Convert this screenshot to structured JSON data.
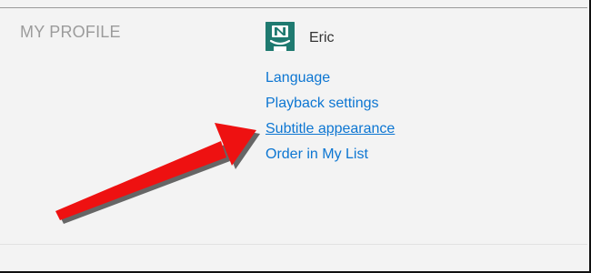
{
  "profile": {
    "section_heading": "MY PROFILE",
    "name": "Eric",
    "avatar_icon": "smiling-n-face-icon",
    "avatar_color": "#1f7a70"
  },
  "settings_links": [
    {
      "label": "Language"
    },
    {
      "label": "Playback settings"
    },
    {
      "label": "Subtitle appearance",
      "highlighted": true
    },
    {
      "label": "Order in My List"
    }
  ],
  "colors": {
    "link": "#0d76d2",
    "heading": "#9b9b9b",
    "arrow": "#ee1111"
  }
}
